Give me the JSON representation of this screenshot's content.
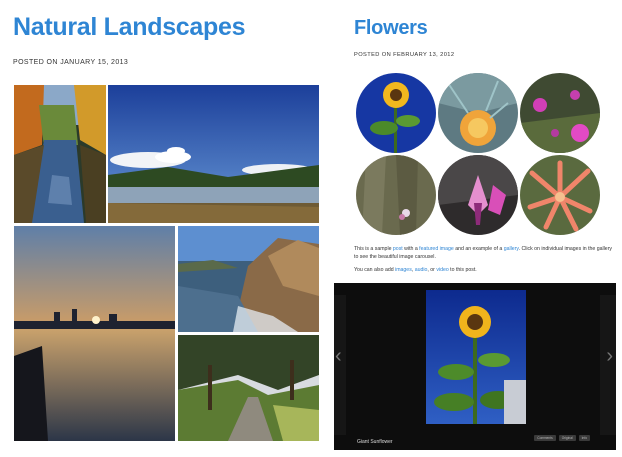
{
  "posts": [
    {
      "title": "Natural Landscapes",
      "meta_label": "POSTED ON",
      "date": "JANUARY 15, 2013"
    },
    {
      "title": "Flowers",
      "meta_label": "POSTED ON",
      "date": "FEBRUARY 13, 2012",
      "body": {
        "p1_a": "This is a sample ",
        "p1_link1": "post",
        "p1_b": " with a ",
        "p1_link2": "featured image",
        "p1_c": " and an example of a ",
        "p1_link3": "gallery",
        "p1_d": ". Click on individual images in the gallery to see the beautiful image carousel.",
        "p2_a": "You can also add ",
        "p2_link1": "images",
        "p2_b": ", ",
        "p2_link2": "audio",
        "p2_c": ", or ",
        "p2_link3": "video",
        "p2_d": " to this post."
      },
      "carousel": {
        "caption": "Giant Sunflower",
        "controls": [
          "Comments",
          "Original",
          "Info"
        ],
        "prev_icon": "chevron-left-icon",
        "next_icon": "chevron-right-icon"
      }
    }
  ],
  "colors": {
    "title": "#2e85d4",
    "link": "#2e85d4",
    "carousel_bg": "#0d0d0d"
  }
}
